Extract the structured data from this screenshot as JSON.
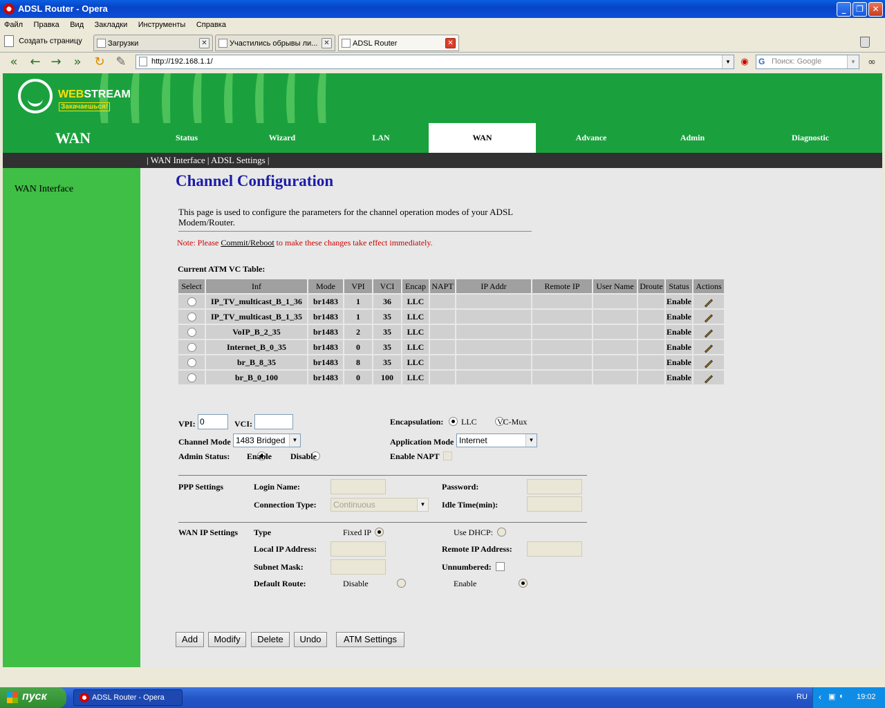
{
  "window": {
    "title": "ADSL Router - Opera"
  },
  "menu": [
    "Файл",
    "Правка",
    "Вид",
    "Закладки",
    "Инструменты",
    "Справка"
  ],
  "tabs": {
    "new_page": "Создать страницу",
    "items": [
      {
        "label": "Загрузки"
      },
      {
        "label": "Участились обрывы ли..."
      },
      {
        "label": "ADSL Router"
      }
    ]
  },
  "address": {
    "url": "http://192.168.1.1/",
    "search_placeholder": "Поиск: Google"
  },
  "banner": {
    "brand_part1": "WEB",
    "brand_part2": "STREAM",
    "slogan": "Закачаешься!"
  },
  "nav": {
    "section_title": "WAN",
    "tabs": [
      "Status",
      "Wizard",
      "LAN",
      "WAN",
      "Advance",
      "Admin",
      "Diagnostic"
    ],
    "active": "WAN",
    "subnav": "| WAN Interface | ADSL Settings |"
  },
  "sidebar": {
    "items": [
      "WAN Interface"
    ]
  },
  "page": {
    "title": "Channel Configuration",
    "description": "This page is used to configure the parameters for the channel operation modes of your ADSL Modem/Router.",
    "note_prefix": "Note: Please ",
    "note_link": "Commit/Reboot",
    "note_suffix": " to make these changes take effect immediately.",
    "table_title": "Current ATM VC Table:"
  },
  "vc_table": {
    "headers": [
      "Select",
      "Inf",
      "Mode",
      "VPI",
      "VCI",
      "Encap",
      "NAPT",
      "IP Addr",
      "Remote IP",
      "User Name",
      "Droute",
      "Status",
      "Actions"
    ],
    "rows": [
      {
        "inf": "IP_TV_multicast_B_1_36",
        "mode": "br1483",
        "vpi": "1",
        "vci": "36",
        "encap": "LLC",
        "napt": "",
        "ip": "",
        "remote": "",
        "user": "",
        "droute": "",
        "status": "Enable"
      },
      {
        "inf": "IP_TV_multicast_B_1_35",
        "mode": "br1483",
        "vpi": "1",
        "vci": "35",
        "encap": "LLC",
        "napt": "",
        "ip": "",
        "remote": "",
        "user": "",
        "droute": "",
        "status": "Enable"
      },
      {
        "inf": "VoIP_B_2_35",
        "mode": "br1483",
        "vpi": "2",
        "vci": "35",
        "encap": "LLC",
        "napt": "",
        "ip": "",
        "remote": "",
        "user": "",
        "droute": "",
        "status": "Enable"
      },
      {
        "inf": "Internet_B_0_35",
        "mode": "br1483",
        "vpi": "0",
        "vci": "35",
        "encap": "LLC",
        "napt": "",
        "ip": "",
        "remote": "",
        "user": "",
        "droute": "",
        "status": "Enable"
      },
      {
        "inf": "br_B_8_35",
        "mode": "br1483",
        "vpi": "8",
        "vci": "35",
        "encap": "LLC",
        "napt": "",
        "ip": "",
        "remote": "",
        "user": "",
        "droute": "",
        "status": "Enable"
      },
      {
        "inf": "br_B_0_100",
        "mode": "br1483",
        "vpi": "0",
        "vci": "100",
        "encap": "LLC",
        "napt": "",
        "ip": "",
        "remote": "",
        "user": "",
        "droute": "",
        "status": "Enable"
      }
    ]
  },
  "form": {
    "vpi_label": "VPI:",
    "vpi_value": "0",
    "vci_label": "VCI:",
    "vci_value": "",
    "encap_label": "Encapsulation:",
    "encap_llc": "LLC",
    "encap_vcmux": "VC-Mux",
    "channel_mode_label": "Channel Mode",
    "channel_mode_value": "1483 Bridged",
    "app_mode_label": "Application Mode",
    "app_mode_value": "Internet",
    "admin_status_label": "Admin Status:",
    "admin_enable": "Enable",
    "admin_disable": "Disable",
    "enable_napt_label": "Enable NAPT",
    "ppp_section": "PPP Settings",
    "login_label": "Login Name:",
    "password_label": "Password:",
    "conn_type_label": "Connection Type:",
    "conn_type_value": "Continuous",
    "idle_label": "Idle Time(min):",
    "wanip_section": "WAN IP Settings",
    "type_label": "Type",
    "fixed_ip": "Fixed IP",
    "use_dhcp": "Use DHCP:",
    "local_ip_label": "Local IP Address:",
    "remote_ip_label": "Remote IP Address:",
    "subnet_label": "Subnet Mask:",
    "unnumbered_label": "Unnumbered:",
    "default_route_label": "Default Route:",
    "dr_disable": "Disable",
    "dr_enable": "Enable"
  },
  "buttons": {
    "add": "Add",
    "modify": "Modify",
    "delete": "Delete",
    "undo": "Undo",
    "atm": "ATM Settings"
  },
  "taskbar": {
    "start": "пуск",
    "item": "ADSL Router - Opera",
    "lang": "RU",
    "clock": "19:02"
  }
}
